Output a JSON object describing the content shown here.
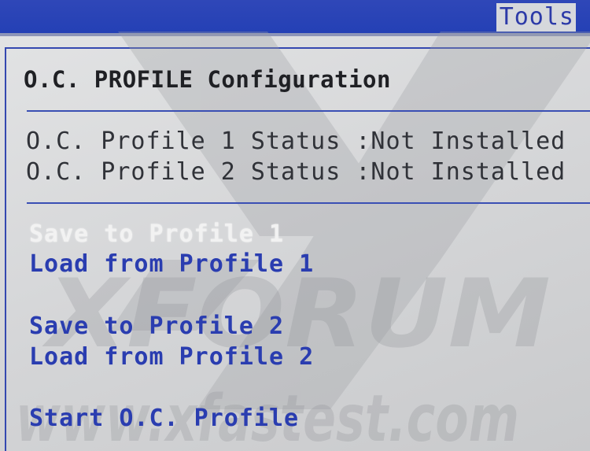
{
  "header": {
    "active_tab": "Tools"
  },
  "page": {
    "title": "O.C. PROFILE Configuration"
  },
  "status": [
    {
      "label": "O.C. Profile 1 Status",
      "value": ":Not Installed"
    },
    {
      "label": "O.C. Profile 2 Status",
      "value": ":Not Installed"
    }
  ],
  "menu": {
    "items": [
      {
        "label": "Save to Profile 1",
        "selected": true
      },
      {
        "label": "Load from Profile 1",
        "selected": false
      },
      {
        "label": "Save to Profile 2",
        "selected": false
      },
      {
        "label": "Load from Profile 2",
        "selected": false
      },
      {
        "label": "Start O.C. Profile",
        "selected": false
      }
    ]
  },
  "watermark": {
    "brand": "XFORUM",
    "site": "www.xfastest.com",
    "logo_icon": "x-logo-icon"
  },
  "colors": {
    "header_blue": "#2440b5",
    "menu_blue": "#2a3db0",
    "selected_text": "#f2f2f2",
    "background": "#d9dadb"
  }
}
